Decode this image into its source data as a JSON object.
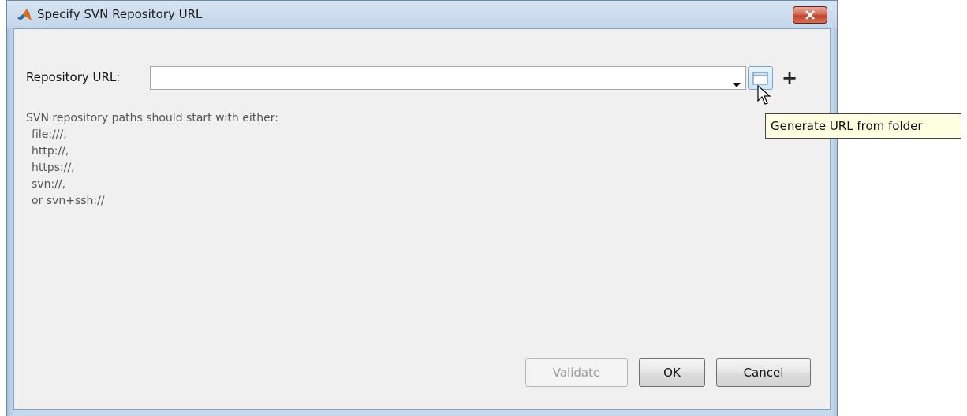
{
  "window": {
    "title": "Specify SVN Repository URL",
    "app_icon": "matlab-logo-icon",
    "close_icon": "close-icon"
  },
  "form": {
    "repo_label": "Repository URL:",
    "repo_value": "",
    "repo_placeholder": "",
    "dropdown_icon": "chevron-down-icon",
    "folder_icon": "folder-icon",
    "plus_label": "+"
  },
  "tooltip": {
    "text": "Generate URL from folder"
  },
  "hint": {
    "lines": [
      "SVN repository paths should start with either:",
      "file:///,",
      "http://,",
      "https://,",
      "svn://,",
      "or svn+ssh://"
    ]
  },
  "buttons": {
    "validate": "Validate",
    "ok": "OK",
    "cancel": "Cancel"
  },
  "colors": {
    "close_red": "#c0432c",
    "tooltip_bg": "#ffffe1",
    "frame_blue": "#c6d8ec"
  }
}
